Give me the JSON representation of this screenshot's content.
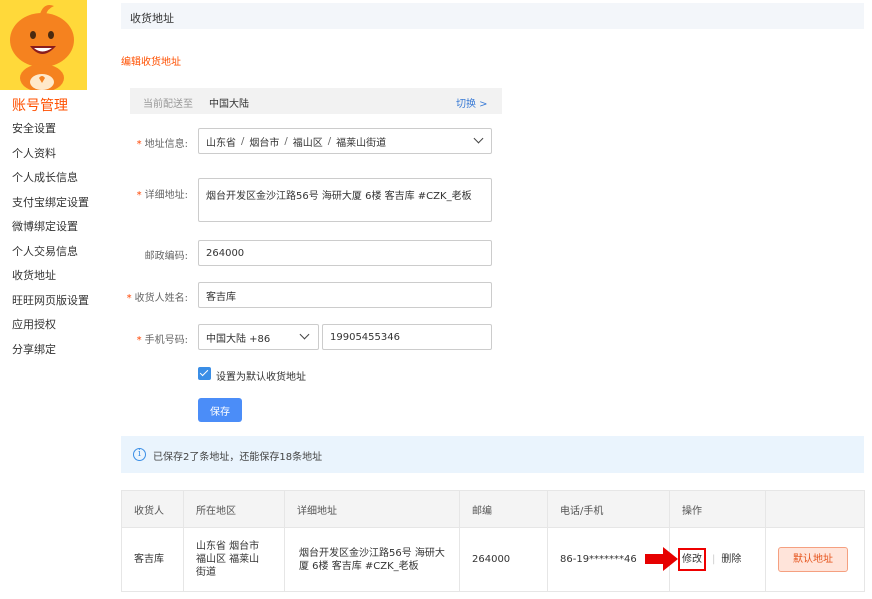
{
  "sidebar": {
    "title": "账号管理",
    "items": [
      {
        "label": "安全设置"
      },
      {
        "label": "个人资料"
      },
      {
        "label": "个人成长信息"
      },
      {
        "label": "支付宝绑定设置"
      },
      {
        "label": "微博绑定设置"
      },
      {
        "label": "个人交易信息"
      },
      {
        "label": "收货地址"
      },
      {
        "label": "旺旺网页版设置"
      },
      {
        "label": "应用授权"
      },
      {
        "label": "分享绑定"
      }
    ]
  },
  "header": {
    "title": "收货地址"
  },
  "form": {
    "title": "编辑收货地址",
    "region_bar": {
      "label": "当前配送至",
      "value": "中国大陆",
      "switch_label": "切换 >"
    },
    "address_info": {
      "label": "地址信息:",
      "province": "山东省",
      "city": "烟台市",
      "district": "福山区",
      "street": "福莱山街道",
      "separator": "/"
    },
    "detail": {
      "label": "详细地址:",
      "value": "烟台开发区金沙江路56号 海研大厦 6楼 客吉库 #CZK_老板"
    },
    "postcode": {
      "label": "邮政编码:",
      "value": "264000"
    },
    "name": {
      "label": "收货人姓名:",
      "value": "客吉库"
    },
    "phone": {
      "label": "手机号码:",
      "country": "中国大陆 +86",
      "value": "19905455346"
    },
    "required_mark": "*",
    "default_checkbox_label": "设置为默认收货地址",
    "default_checked": true,
    "save_label": "保存"
  },
  "info": {
    "icon": "info-icon",
    "text": "已保存2了条地址，还能保存18条地址"
  },
  "table": {
    "headers": [
      "收货人",
      "所在地区",
      "详细地址",
      "邮编",
      "电话/手机",
      "操作",
      ""
    ],
    "rows": [
      {
        "name": "客吉库",
        "region": "山东省 烟台市 福山区 福莱山 街道",
        "address": "烟台开发区金沙江路56号 海研大厦 6楼 客吉库 #CZK_老板",
        "postcode": "264000",
        "phone": "86-19*******46",
        "edit_label": "修改",
        "op_separator": "|",
        "delete_label": "删除",
        "default_label": "默认地址"
      }
    ]
  },
  "colors": {
    "accent": "#ff5000",
    "link": "#3a7bd5",
    "primary_button": "#4b8df8",
    "highlight": "#e00000"
  }
}
